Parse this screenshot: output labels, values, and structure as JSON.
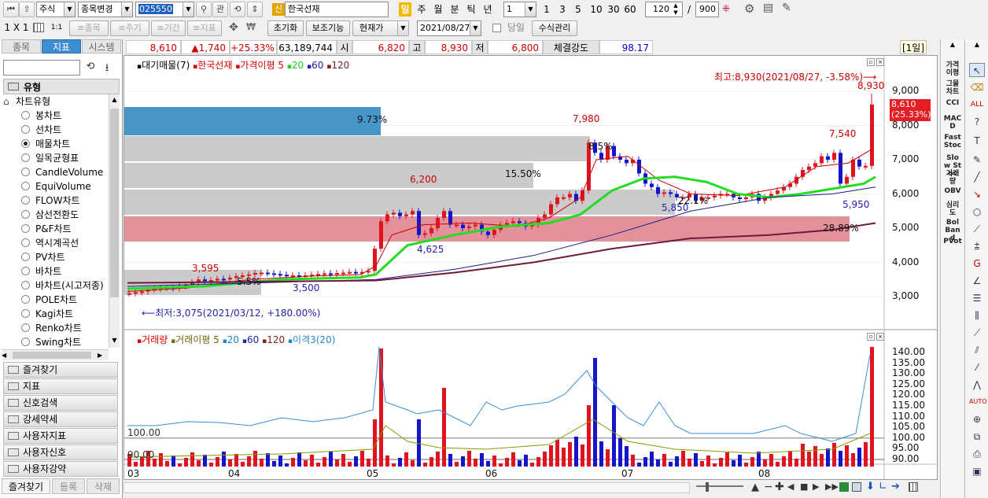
{
  "toolbar1": {
    "market_select": "주식",
    "code_change_select": "종목변경",
    "stock_code": "025550",
    "related_btn": "관",
    "new_badge": "신",
    "stock_name": "한국선재",
    "period_day": "일",
    "period_week": "주",
    "period_month": "월",
    "period_minute": "분",
    "period_tick": "틱",
    "period_year": "년",
    "interval_value": "1",
    "interval_presets": [
      "1",
      "3",
      "5",
      "10",
      "30",
      "60"
    ],
    "display_count": "120",
    "total_count": "900",
    "slash": "/"
  },
  "toolbar2": {
    "layout_label": "1 X 1",
    "one_to_one": "1:1",
    "stock_btn": "≡종목",
    "cycle_btn": "≡주기",
    "period_btn": "≡기간",
    "indicator_btn": "≡지표",
    "reset_btn": "초기화",
    "aux_btn": "보조기능",
    "price_type": "현재가",
    "date_value": "2021/08/27",
    "sameday_label": "당일",
    "formula_btn": "수식관리"
  },
  "left_panel": {
    "tabs": [
      "종목",
      "지표",
      "시스템"
    ],
    "active_tab": "지표",
    "section_title": "유형",
    "tree_root": "차트유형",
    "chart_types": [
      "봉차트",
      "선차트",
      "매물차트",
      "일목균형표",
      "CandleVolume",
      "EquiVolume",
      "FLOW차트",
      "삼선전환도",
      "P&F차트",
      "역시계곡선",
      "PV차트",
      "바차트",
      "바차트(시고저종)",
      "POLE차트",
      "Kagi차트",
      "Renko차트",
      "Swing차트"
    ],
    "selected_type": "매물차트",
    "categories": [
      "즐겨찾기",
      "지표",
      "신호검색",
      "강세약세",
      "사용자지표",
      "사용자신호",
      "사용자강약"
    ],
    "bottom_tabs": [
      "즐겨찾기",
      "등록",
      "삭제"
    ]
  },
  "info_bar": {
    "price": "8,610",
    "change": "▲1,740",
    "change_pct": "+25.33%",
    "volume": "63,189,744",
    "open_label": "시",
    "open": "6,820",
    "high_label": "고",
    "high": "8,930",
    "low_label": "저",
    "low": "6,800",
    "strength_label": "체결강도",
    "strength": "98.17",
    "period_tag": "[1일]"
  },
  "price_chart": {
    "legend": {
      "volume_profile": "대기매물(7)",
      "stock": "한국선재",
      "ma_label": "가격이평",
      "ma5": "5",
      "ma20": "20",
      "ma60": "60",
      "ma120": "120"
    },
    "annotations": {
      "high_note": "최고:8,930(2021/08/27, -3.58%)⟶",
      "low_note": "⟵최저:3,075(2021/03/12, +180.00%)",
      "current_price_tag": "8,610",
      "current_pct_tag": "(25.33%)",
      "peaks": [
        "8,930",
        "7,980",
        "7,540",
        "6,200",
        "3,595"
      ],
      "troughs": [
        "4,625",
        "3,500",
        "5,850",
        "5,950"
      ],
      "profile_pcts": [
        "9.73%",
        "15.50%",
        "28.89%",
        "8.5%",
        "22.1%",
        "5.5%"
      ]
    },
    "y_ticks": [
      "9,000",
      "8,000",
      "7,000",
      "6,000",
      "5,000",
      "4,000",
      "3,000"
    ],
    "colors": {
      "up": "#e0141e",
      "down": "#1414c8",
      "ma5": "#c80000",
      "ma20": "#22dd22",
      "ma60": "#1a1a8c",
      "ma120": "#6e1a3c",
      "profile_hi": "#e28b96",
      "profile_blue": "#3d8fc6"
    }
  },
  "volume_chart": {
    "legend": {
      "volume": "거래량",
      "ma_label": "거래이평",
      "ma5": "5",
      "ma20": "20",
      "ma60": "60",
      "ma120": "120",
      "disparity": "이격3(20)"
    },
    "ref_lines": [
      "100.00",
      "90.00"
    ],
    "y_ticks": [
      "140.00",
      "135.00",
      "130.00",
      "125.00",
      "120.00",
      "115.00",
      "110.00",
      "105.00",
      "100.00",
      "95.00",
      "90.00"
    ]
  },
  "x_axis": [
    "03",
    "04",
    "05",
    "06",
    "07",
    "08"
  ],
  "right_indicators": [
    "가격이평",
    "그물차트",
    "CCI",
    "MACD",
    "Fast Stoc",
    "Slow Stoc",
    "거래량",
    "OBV",
    "심리도",
    "Bol Band",
    "PVot"
  ],
  "chart_data": {
    "type": "candlestick",
    "x": [
      "2021-03",
      "2021-04",
      "2021-05",
      "2021-06",
      "2021-07",
      "2021-08"
    ],
    "high": 8930,
    "low": 3075,
    "last": 8610,
    "open": 6820,
    "day_high": 8930,
    "day_low": 6800,
    "ylim": [
      2800,
      9400
    ]
  }
}
